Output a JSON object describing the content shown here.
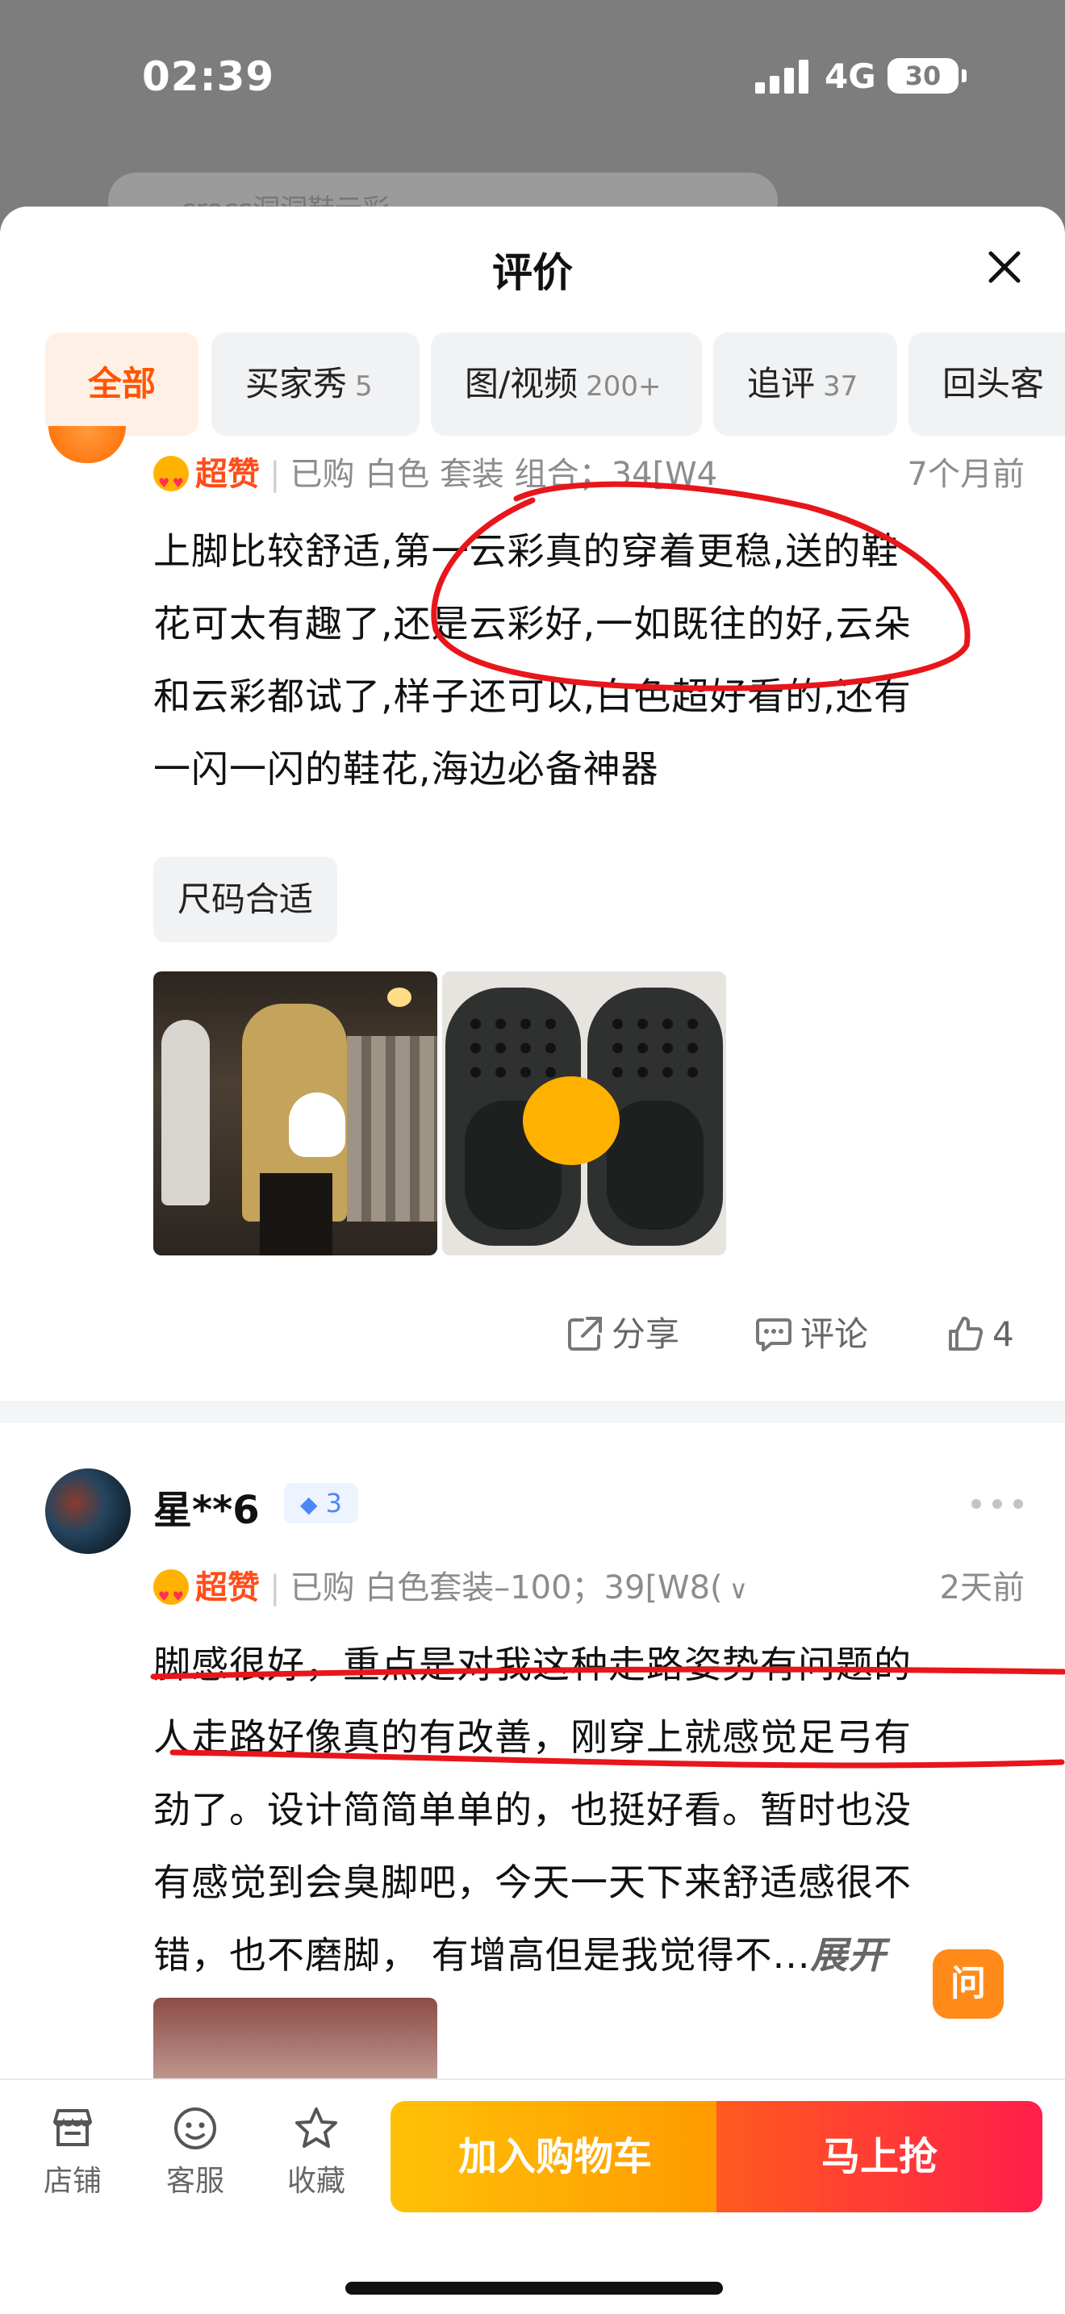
{
  "status_bar": {
    "time": "02:39",
    "network": "4G",
    "battery": "30"
  },
  "background": {
    "search_placeholder": "crocs洞洞鞋云彩"
  },
  "sheet": {
    "title": "评价",
    "tabs": [
      {
        "label": "全部",
        "count": ""
      },
      {
        "label": "买家秀",
        "count": "5"
      },
      {
        "label": "图/视频",
        "count": "200+"
      },
      {
        "label": "追评",
        "count": "37"
      },
      {
        "label": "回头客",
        "count": ""
      }
    ]
  },
  "reviews": [
    {
      "badge": "超赞",
      "purchased": "已购 白色 套装 组合；34[W4",
      "time_ago": "7个月前",
      "text_lines": [
        "上脚比较舒适,第一云彩真的穿着更稳,送的鞋",
        "花可太有趣了,还是云彩好,一如既往的好,云朵",
        "和云彩都试了,样子还可以,白色超好看的,还有",
        "一闪一闪的鞋花,海边必备神器"
      ],
      "tag": "尺码合适",
      "actions": {
        "share": "分享",
        "comment": "评论",
        "like_count": "4"
      }
    },
    {
      "username": "星**6",
      "vip_level": "3",
      "badge": "超赞",
      "purchased": "已购 白色套装–100；39[W8(",
      "time_ago": "2天前",
      "text_lines": [
        "脚感很好，重点是对我这种走路姿势有问题的",
        "人走路好像真的有改善，刚穿上就感觉足弓有",
        "劲了。设计简简单单的，也挺好看。暂时也没",
        "有感觉到会臭脚吧，今天一天下来舒适感很不",
        "错，也不磨脚， 有增高但是我觉得不..."
      ],
      "expand_label": "展开"
    }
  ],
  "float_ask": "问",
  "bottom_bar": {
    "store": "店铺",
    "service": "客服",
    "favorite": "收藏",
    "add_cart": "加入购物车",
    "buy_now": "马上抢"
  },
  "colors": {
    "accent": "#ff5500",
    "annotation": "#e8151b"
  }
}
